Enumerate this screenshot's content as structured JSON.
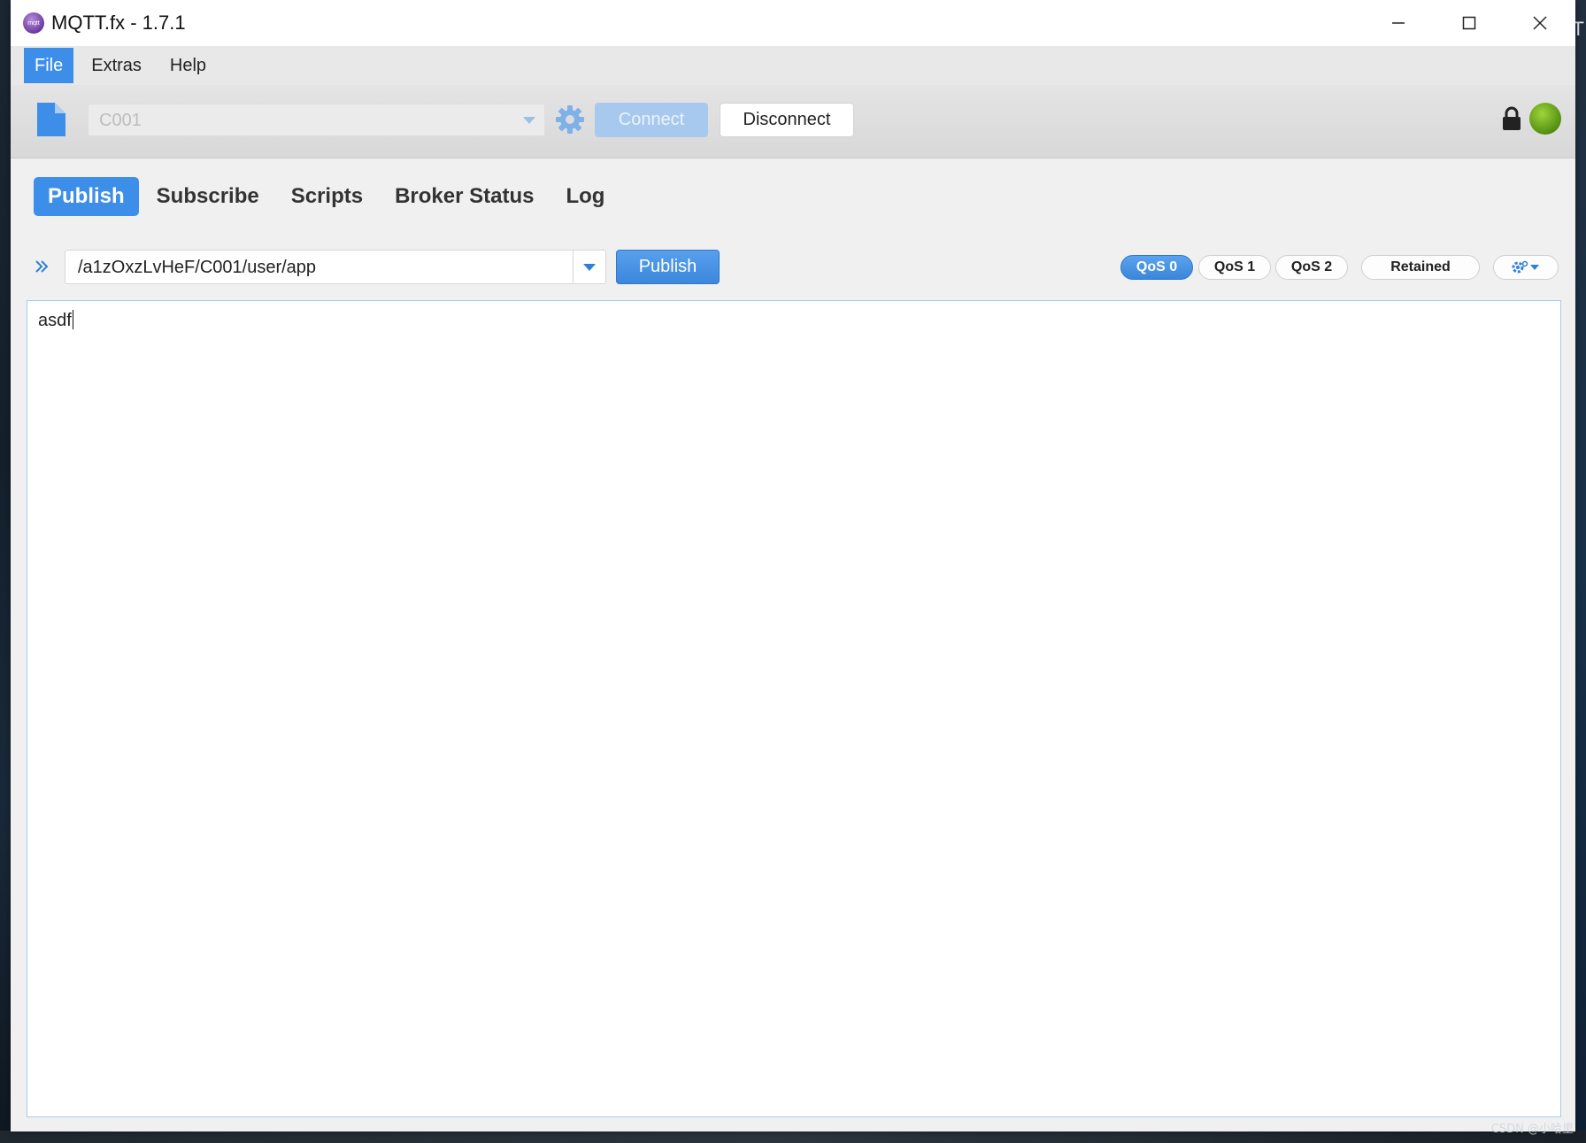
{
  "window": {
    "title": "MQTT.fx - 1.7.1"
  },
  "menu": {
    "items": [
      "File",
      "Extras",
      "Help"
    ]
  },
  "toolbar": {
    "profile_value": "C001",
    "connect_label": "Connect",
    "disconnect_label": "Disconnect",
    "connected": true,
    "status_color": "#6aad1e"
  },
  "tabs": [
    "Publish",
    "Subscribe",
    "Scripts",
    "Broker Status",
    "Log"
  ],
  "publish": {
    "topic": "/a1zOxzLvHeF/C001/user/app",
    "button_label": "Publish",
    "qos": [
      "QoS 0",
      "QoS 1",
      "QoS 2"
    ],
    "qos_selected": "QoS 0",
    "retained_label": "Retained",
    "payload": "asdf"
  },
  "watermark": "CSDN @小哈里",
  "colors": {
    "accent": "#3d8ee8"
  }
}
